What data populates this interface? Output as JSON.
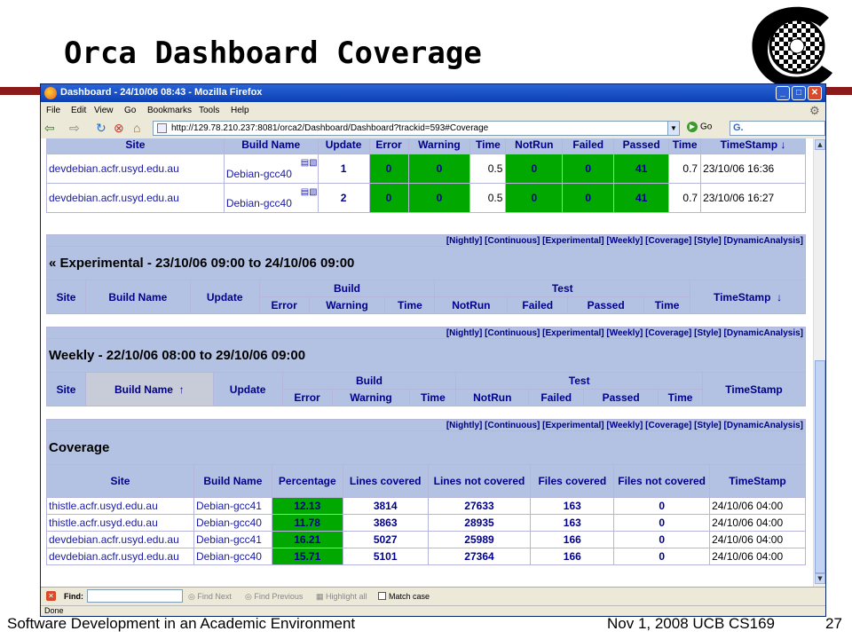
{
  "slide": {
    "title": "Orca Dashboard Coverage",
    "footer_left": "Software Development in an Academic Environment",
    "footer_date": "Nov 1, 2008 UCB CS169",
    "page_number": "27"
  },
  "browser": {
    "window_title": "Dashboard - 24/10/06 08:43 - Mozilla Firefox",
    "menu": [
      "File",
      "Edit",
      "View",
      "Go",
      "Bookmarks",
      "Tools",
      "Help"
    ],
    "url": "http://129.78.210.237:8081/orca2/Dashboard/Dashboard?trackid=593#Coverage",
    "go_label": "Go",
    "search_placeholder": "G.",
    "find_label": "Find:",
    "find_next": "Find Next",
    "find_previous": "Find Previous",
    "highlight_all": "Highlight all",
    "match_case": "Match case",
    "status": "Done"
  },
  "nav_links": [
    "[Nightly]",
    "[Continuous]",
    "[Experimental]",
    "[Weekly]",
    "[Coverage]",
    "[Style]",
    "[DynamicAnalysis]"
  ],
  "columns": {
    "site": "Site",
    "build_name": "Build Name",
    "update": "Update",
    "build": "Build",
    "test": "Test",
    "error": "Error",
    "warning": "Warning",
    "time": "Time",
    "notrun": "NotRun",
    "failed": "Failed",
    "passed": "Passed",
    "timestamp": "TimeStamp",
    "down_arrow": "↓",
    "up_arrow": "↑"
  },
  "continuous": {
    "rows": [
      {
        "site": "devdebian.acfr.usyd.edu.au",
        "build": "Debian-gcc40",
        "update": "1",
        "error": "0",
        "warning": "0",
        "build_time": "0.5",
        "notrun": "0",
        "failed": "0",
        "passed": "41",
        "test_time": "0.7",
        "timestamp": "23/10/06 16:36"
      },
      {
        "site": "devdebian.acfr.usyd.edu.au",
        "build": "Debian-gcc40",
        "update": "2",
        "error": "0",
        "warning": "0",
        "build_time": "0.5",
        "notrun": "0",
        "failed": "0",
        "passed": "41",
        "test_time": "0.7",
        "timestamp": "23/10/06 16:27"
      }
    ]
  },
  "experimental": {
    "title": "« Experimental - 23/10/06 09:00 to 24/10/06 09:00"
  },
  "weekly": {
    "title": "Weekly - 22/10/06 08:00 to 29/10/06 09:00"
  },
  "coverage": {
    "title": "Coverage",
    "headers": {
      "site": "Site",
      "build_name": "Build Name",
      "percentage": "Percentage",
      "lines_covered": "Lines covered",
      "lines_not_covered": "Lines not covered",
      "files_covered": "Files covered",
      "files_not_covered": "Files not covered",
      "timestamp": "TimeStamp"
    },
    "rows": [
      {
        "site": "thistle.acfr.usyd.edu.au",
        "build": "Debian-gcc41",
        "percentage": "12.13",
        "lines_covered": "3814",
        "lines_not_covered": "27633",
        "files_covered": "163",
        "files_not_covered": "0",
        "timestamp": "24/10/06 04:00"
      },
      {
        "site": "thistle.acfr.usyd.edu.au",
        "build": "Debian-gcc40",
        "percentage": "11.78",
        "lines_covered": "3863",
        "lines_not_covered": "28935",
        "files_covered": "163",
        "files_not_covered": "0",
        "timestamp": "24/10/06 04:00"
      },
      {
        "site": "devdebian.acfr.usyd.edu.au",
        "build": "Debian-gcc41",
        "percentage": "16.21",
        "lines_covered": "5027",
        "lines_not_covered": "25989",
        "files_covered": "166",
        "files_not_covered": "0",
        "timestamp": "24/10/06 04:00"
      },
      {
        "site": "devdebian.acfr.usyd.edu.au",
        "build": "Debian-gcc40",
        "percentage": "15.71",
        "lines_covered": "5101",
        "lines_not_covered": "27364",
        "files_covered": "166",
        "files_not_covered": "0",
        "timestamp": "24/10/06 04:00"
      }
    ]
  },
  "colors": {
    "pass_green": "#00a800",
    "header_blue": "#b3c2e3",
    "link_navy": "#00008b",
    "slide_rule": "#8b1a1a"
  }
}
